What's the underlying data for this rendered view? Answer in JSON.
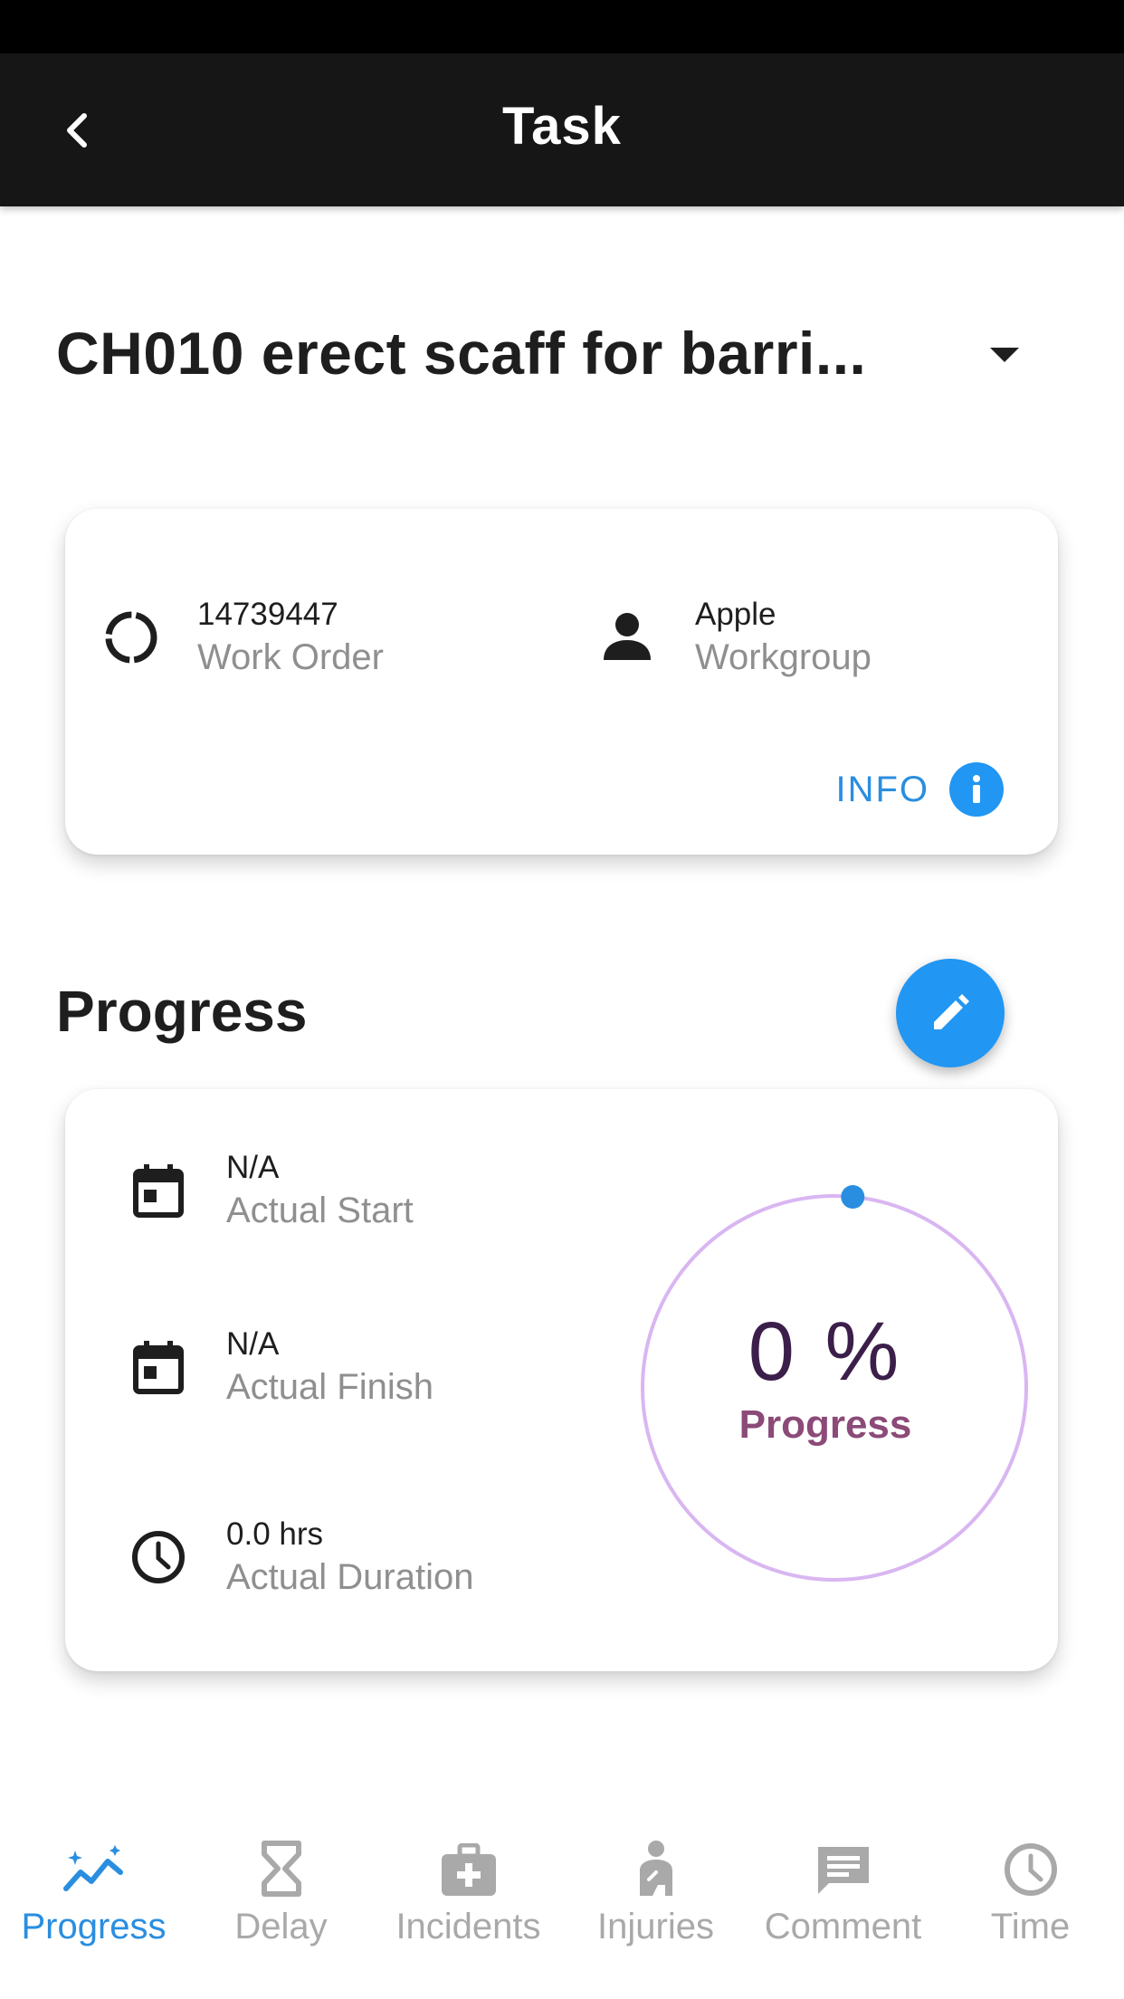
{
  "app_bar": {
    "title": "Task"
  },
  "task": {
    "title": "CH010 erect scaff for barri..."
  },
  "info_card": {
    "work_order": {
      "value": "14739447",
      "label": "Work Order"
    },
    "workgroup": {
      "value": "Apple",
      "label": "Workgroup"
    },
    "info_label": "INFO"
  },
  "progress_section": {
    "title": "Progress",
    "actual_start": {
      "value": "N/A",
      "label": "Actual Start"
    },
    "actual_finish": {
      "value": "N/A",
      "label": "Actual Finish"
    },
    "actual_duration": {
      "value": "0.0 hrs",
      "label": "Actual Duration"
    },
    "ring": {
      "value_text": "0 %",
      "label": "Progress",
      "percent": 0
    }
  },
  "bottom_nav": [
    {
      "label": "Progress",
      "icon": "progress-chart-icon",
      "active": true
    },
    {
      "label": "Delay",
      "icon": "hourglass-icon",
      "active": false
    },
    {
      "label": "Incidents",
      "icon": "medical-kit-icon",
      "active": false
    },
    {
      "label": "Injuries",
      "icon": "injured-person-icon",
      "active": false
    },
    {
      "label": "Comment",
      "icon": "comment-icon",
      "active": false
    },
    {
      "label": "Time",
      "icon": "clock-icon",
      "active": false
    }
  ],
  "colors": {
    "accent": "#2196f3",
    "app_bar": "#161616",
    "ring_track": "#d9b6f2",
    "ring_label": "#8b4a78",
    "inactive_nav": "#a9a9a9"
  }
}
